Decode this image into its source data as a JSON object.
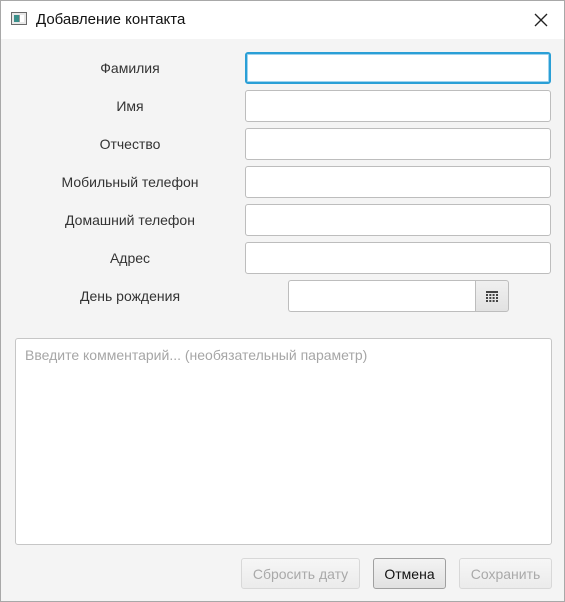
{
  "window": {
    "title": "Добавление контакта",
    "icon": "app-window-icon",
    "close_icon": "close-icon"
  },
  "form": {
    "fields": [
      {
        "label": "Фамилия",
        "value": "",
        "focused": true
      },
      {
        "label": "Имя",
        "value": ""
      },
      {
        "label": "Отчество",
        "value": ""
      },
      {
        "label": "Мобильный телефон",
        "value": ""
      },
      {
        "label": "Домашний телефон",
        "value": ""
      },
      {
        "label": "Адрес",
        "value": ""
      }
    ],
    "birthday": {
      "label": "День рождения",
      "value": "",
      "icon": "calendar-icon"
    },
    "comment": {
      "placeholder": "Введите комментарий... (необязательный параметр)",
      "value": ""
    }
  },
  "buttons": {
    "reset_date": "Сбросить дату",
    "cancel": "Отмена",
    "save": "Сохранить"
  },
  "colors": {
    "focus_border": "#2a9fd6",
    "disabled_text": "#a9a9a9"
  }
}
